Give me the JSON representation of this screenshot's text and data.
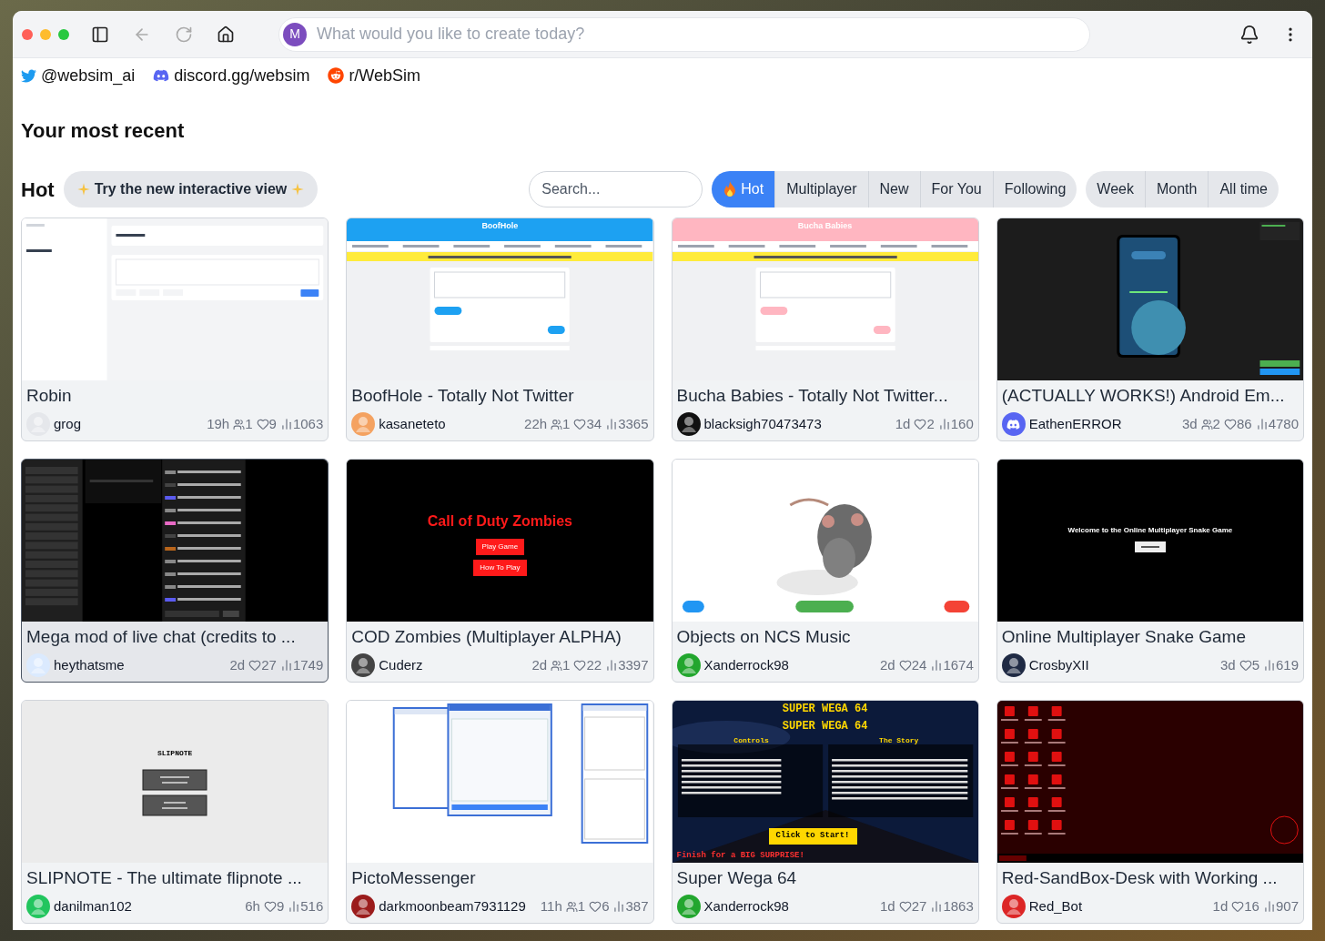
{
  "browser": {
    "avatar_letter": "M",
    "address_placeholder": "What would you like to create today?"
  },
  "social_links": [
    {
      "kind": "twitter",
      "label": "@websim_ai"
    },
    {
      "kind": "discord",
      "label": "discord.gg/websim"
    },
    {
      "kind": "reddit",
      "label": "r/WebSim"
    }
  ],
  "recent_heading": "Your most recent",
  "feed": {
    "heading": "Hot",
    "interactive_button": "Try the new interactive view",
    "search_placeholder": "Search...",
    "sort_tabs": [
      {
        "label": "Hot",
        "selected": true
      },
      {
        "label": "Multiplayer",
        "selected": false
      },
      {
        "label": "New",
        "selected": false
      },
      {
        "label": "For You",
        "selected": false
      },
      {
        "label": "Following",
        "selected": false
      }
    ],
    "time_tabs": [
      {
        "label": "Week",
        "selected": false
      },
      {
        "label": "Month",
        "selected": false
      },
      {
        "label": "All time",
        "selected": false
      }
    ]
  },
  "cards": [
    {
      "title": "Robin",
      "author": "grog",
      "time": "19h",
      "users": "1",
      "likes": "9",
      "views": "1063",
      "hovered": false,
      "thumb": {
        "kind": "social_feed"
      }
    },
    {
      "title": "BoofHole - Totally Not Twitter",
      "author": "kasaneteto",
      "time": "22h",
      "users": "1",
      "likes": "34",
      "views": "3365",
      "hovered": false,
      "thumb": {
        "kind": "microblog",
        "title": "BoofHole"
      }
    },
    {
      "title": "Bucha Babies - Totally Not Twitter...",
      "author": "blacksigh70473473",
      "time": "1d",
      "likes": "2",
      "views": "160",
      "hovered": false,
      "thumb": {
        "kind": "microblog_pink",
        "title": "Bucha Babies"
      }
    },
    {
      "title": "(ACTUALLY WORKS!) Android Em...",
      "author": "EathenERROR",
      "avatar": {
        "kind": "discord",
        "color": "#5865f2"
      },
      "time": "3d",
      "users": "2",
      "likes": "86",
      "views": "4780",
      "hovered": false,
      "thumb": {
        "kind": "emulator"
      }
    },
    {
      "title": "Mega mod of live chat (credits to ...",
      "author": "heythatsme",
      "time": "2d",
      "likes": "27",
      "views": "1749",
      "hovered": true,
      "thumb": {
        "kind": "live_chat"
      }
    },
    {
      "title": "COD Zombies (Multiplayer ALPHA)",
      "author": "Cuderz",
      "time": "2d",
      "users": "1",
      "likes": "22",
      "views": "3397",
      "hovered": false,
      "thumb": {
        "kind": "game_menu",
        "title": "Call of Duty Zombies",
        "buttons": [
          "Play Game",
          "How To Play"
        ]
      }
    },
    {
      "title": "Objects on NCS Music",
      "author": "Xanderrock98",
      "time": "2d",
      "likes": "24",
      "views": "1674",
      "hovered": false,
      "thumb": {
        "kind": "image_player"
      }
    },
    {
      "title": "Online Multiplayer Snake Game",
      "author": "CrosbyXII",
      "time": "3d",
      "likes": "5",
      "views": "619",
      "hovered": false,
      "thumb": {
        "kind": "splash",
        "heading": "Welcome to the Online Multiplayer Snake Game"
      }
    },
    {
      "title": "SLIPNOTE - The ultimate flipnote ...",
      "author": "danilman102",
      "time": "6h",
      "likes": "9",
      "views": "516",
      "hovered": false,
      "thumb": {
        "kind": "app_menu",
        "title": "SLIPNOTE"
      }
    },
    {
      "title": "PictoMessenger",
      "author": "darkmoonbeam7931129",
      "time": "11h",
      "users": "1",
      "likes": "6",
      "views": "387",
      "hovered": false,
      "thumb": {
        "kind": "windows"
      }
    },
    {
      "title": "Super Wega 64",
      "author": "Xanderrock98",
      "time": "1d",
      "likes": "27",
      "views": "1863",
      "hovered": false,
      "thumb": {
        "kind": "retro_game",
        "titles": [
          "SUPER WEGA 64",
          "SUPER WEGA 64"
        ],
        "panel_headings": [
          "Controls",
          "The Story"
        ],
        "start_button": "Click to Start!",
        "footer": "Finish for a BIG SURPRISE!"
      }
    },
    {
      "title": "Red-SandBox-Desk with Working ...",
      "author": "Red_Bot",
      "time": "1d",
      "likes": "16",
      "views": "907",
      "hovered": false,
      "thumb": {
        "kind": "desktop"
      }
    }
  ]
}
